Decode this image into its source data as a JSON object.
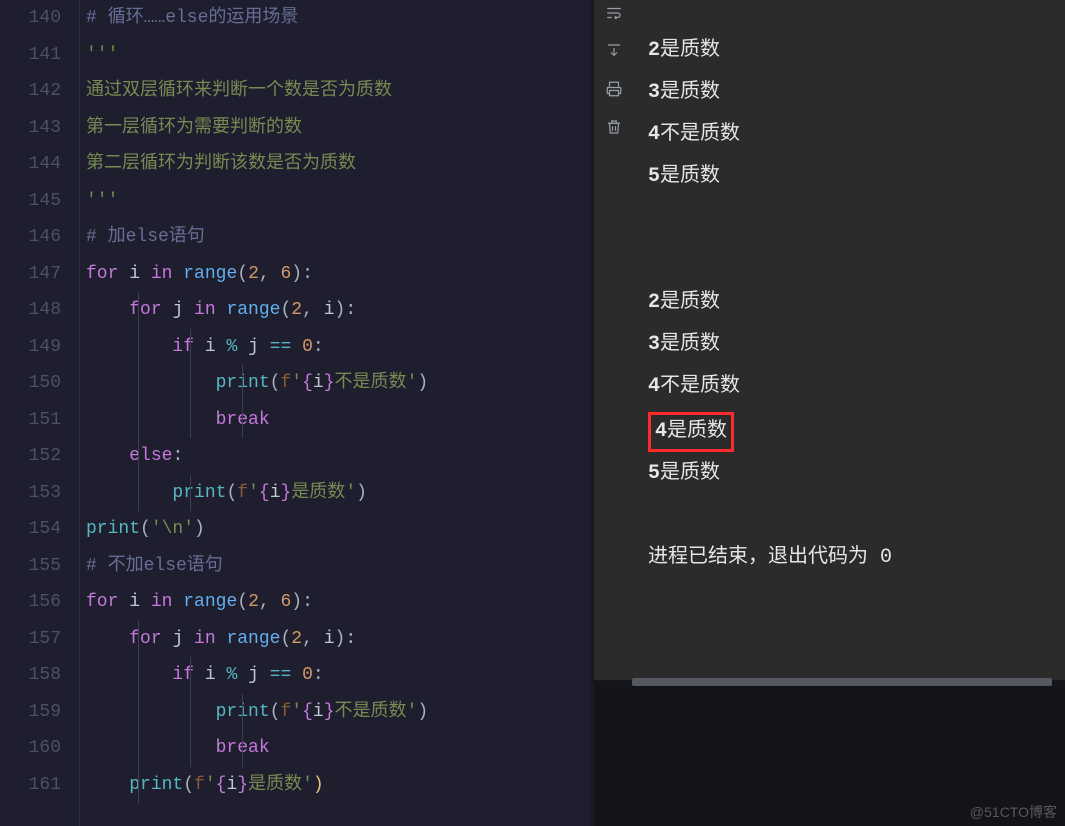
{
  "gutter_start": 140,
  "gutter_end": 161,
  "code_lines": [
    {
      "t": "comment",
      "raw": "# 循环……else的运用场景"
    },
    {
      "t": "docstr",
      "raw": "'''"
    },
    {
      "t": "docstr",
      "raw": "通过双层循环来判断一个数是否为质数"
    },
    {
      "t": "docstr",
      "raw": "第一层循环为需要判断的数"
    },
    {
      "t": "docstr",
      "raw": "第二层循环为判断该数是否为质数"
    },
    {
      "t": "docstr",
      "raw": "'''"
    },
    {
      "t": "comment",
      "raw": "# 加else语句"
    },
    {
      "t": "code",
      "tokens": [
        [
          "for ",
          "keyword"
        ],
        [
          "i ",
          "ident"
        ],
        [
          "in ",
          "keyword"
        ],
        [
          "range",
          "funcname"
        ],
        [
          "(",
          "punct"
        ],
        [
          "2",
          "num"
        ],
        [
          ", ",
          "punct"
        ],
        [
          "6",
          "num"
        ],
        [
          "):",
          "punct"
        ]
      ]
    },
    {
      "t": "code",
      "guides": [
        1
      ],
      "tokens": [
        [
          "    ",
          "ident"
        ],
        [
          "for ",
          "keyword"
        ],
        [
          "j ",
          "ident"
        ],
        [
          "in ",
          "keyword"
        ],
        [
          "range",
          "funcname"
        ],
        [
          "(",
          "punct"
        ],
        [
          "2",
          "num"
        ],
        [
          ", ",
          "punct"
        ],
        [
          "i",
          "ident"
        ],
        [
          "):",
          "punct"
        ]
      ]
    },
    {
      "t": "code",
      "guides": [
        1,
        2
      ],
      "tokens": [
        [
          "        ",
          "ident"
        ],
        [
          "if ",
          "keyword"
        ],
        [
          "i ",
          "ident"
        ],
        [
          "% ",
          "op"
        ],
        [
          "j ",
          "ident"
        ],
        [
          "== ",
          "op"
        ],
        [
          "0",
          "num"
        ],
        [
          ":",
          "punct"
        ]
      ]
    },
    {
      "t": "code",
      "guides": [
        1,
        2,
        3
      ],
      "tokens": [
        [
          "            ",
          "ident"
        ],
        [
          "print",
          "func"
        ],
        [
          "(",
          "punct"
        ],
        [
          "f",
          "fstr"
        ],
        [
          "'",
          "string"
        ],
        [
          "{",
          "fbrace"
        ],
        [
          "i",
          "ident"
        ],
        [
          "}",
          "fbrace"
        ],
        [
          "不是质数",
          "string"
        ],
        [
          "'",
          "string"
        ],
        [
          ")",
          "punct"
        ]
      ]
    },
    {
      "t": "code",
      "guides": [
        1,
        2,
        3
      ],
      "tokens": [
        [
          "            ",
          "ident"
        ],
        [
          "break",
          "keyword"
        ]
      ]
    },
    {
      "t": "code",
      "guides": [
        1
      ],
      "tokens": [
        [
          "    ",
          "ident"
        ],
        [
          "else",
          "keyword"
        ],
        [
          ":",
          "punct"
        ]
      ]
    },
    {
      "t": "code",
      "guides": [
        1,
        2
      ],
      "tokens": [
        [
          "        ",
          "ident"
        ],
        [
          "print",
          "func"
        ],
        [
          "(",
          "punct"
        ],
        [
          "f",
          "fstr"
        ],
        [
          "'",
          "string"
        ],
        [
          "{",
          "fbrace"
        ],
        [
          "i",
          "ident"
        ],
        [
          "}",
          "fbrace"
        ],
        [
          "是质数",
          "string"
        ],
        [
          "'",
          "string"
        ],
        [
          ")",
          "punct"
        ]
      ]
    },
    {
      "t": "code",
      "tokens": [
        [
          "print",
          "func"
        ],
        [
          "(",
          "punct"
        ],
        [
          "'\\n'",
          "string"
        ],
        [
          ")",
          "punct"
        ]
      ]
    },
    {
      "t": "comment",
      "raw": "# 不加else语句"
    },
    {
      "t": "code",
      "tokens": [
        [
          "for ",
          "keyword"
        ],
        [
          "i ",
          "ident"
        ],
        [
          "in ",
          "keyword"
        ],
        [
          "range",
          "funcname"
        ],
        [
          "(",
          "punct"
        ],
        [
          "2",
          "num"
        ],
        [
          ", ",
          "punct"
        ],
        [
          "6",
          "num"
        ],
        [
          "):",
          "punct"
        ]
      ]
    },
    {
      "t": "code",
      "guides": [
        1
      ],
      "tokens": [
        [
          "    ",
          "ident"
        ],
        [
          "for ",
          "keyword"
        ],
        [
          "j ",
          "ident"
        ],
        [
          "in ",
          "keyword"
        ],
        [
          "range",
          "funcname"
        ],
        [
          "(",
          "punct"
        ],
        [
          "2",
          "num"
        ],
        [
          ", ",
          "punct"
        ],
        [
          "i",
          "ident"
        ],
        [
          "):",
          "punct"
        ]
      ]
    },
    {
      "t": "code",
      "guides": [
        1,
        2
      ],
      "tokens": [
        [
          "        ",
          "ident"
        ],
        [
          "if ",
          "keyword"
        ],
        [
          "i ",
          "ident"
        ],
        [
          "% ",
          "op"
        ],
        [
          "j ",
          "ident"
        ],
        [
          "== ",
          "op"
        ],
        [
          "0",
          "num"
        ],
        [
          ":",
          "punct"
        ]
      ]
    },
    {
      "t": "code",
      "guides": [
        1,
        2,
        3
      ],
      "tokens": [
        [
          "            ",
          "ident"
        ],
        [
          "print",
          "func"
        ],
        [
          "(",
          "punct"
        ],
        [
          "f",
          "fstr"
        ],
        [
          "'",
          "string"
        ],
        [
          "{",
          "fbrace"
        ],
        [
          "i",
          "ident"
        ],
        [
          "}",
          "fbrace"
        ],
        [
          "不是质数",
          "string"
        ],
        [
          "'",
          "string"
        ],
        [
          ")",
          "punct"
        ]
      ]
    },
    {
      "t": "code",
      "guides": [
        1,
        2,
        3
      ],
      "tokens": [
        [
          "            ",
          "ident"
        ],
        [
          "break",
          "keyword"
        ]
      ]
    },
    {
      "t": "code",
      "guides": [
        1
      ],
      "tokens": [
        [
          "    ",
          "ident"
        ],
        [
          "print",
          "func"
        ],
        [
          "(",
          "punct"
        ],
        [
          "f",
          "fstr"
        ],
        [
          "'",
          "string"
        ],
        [
          "{",
          "fbrace"
        ],
        [
          "i",
          "ident"
        ],
        [
          "}",
          "fbrace"
        ],
        [
          "是质数",
          "string"
        ],
        [
          "'",
          "string"
        ],
        [
          ")",
          "yellow"
        ]
      ]
    }
  ],
  "output": {
    "block1": [
      {
        "num": "2",
        "text": "是质数"
      },
      {
        "num": "3",
        "text": "是质数"
      },
      {
        "num": "4",
        "text": "不是质数"
      },
      {
        "num": "5",
        "text": "是质数"
      }
    ],
    "block2": [
      {
        "num": "2",
        "text": "是质数"
      },
      {
        "num": "3",
        "text": "是质数"
      },
      {
        "num": "4",
        "text": "不是质数"
      },
      {
        "num": "4",
        "text": "是质数",
        "highlight": true
      },
      {
        "num": "5",
        "text": "是质数"
      }
    ],
    "exit_line": "进程已结束，退出代码为 0"
  },
  "watermark": "@51CTO博客",
  "icons": {
    "wrap": "soft-wrap-icon",
    "scroll": "scroll-to-end-icon",
    "print": "print-icon",
    "trash": "trash-icon"
  }
}
